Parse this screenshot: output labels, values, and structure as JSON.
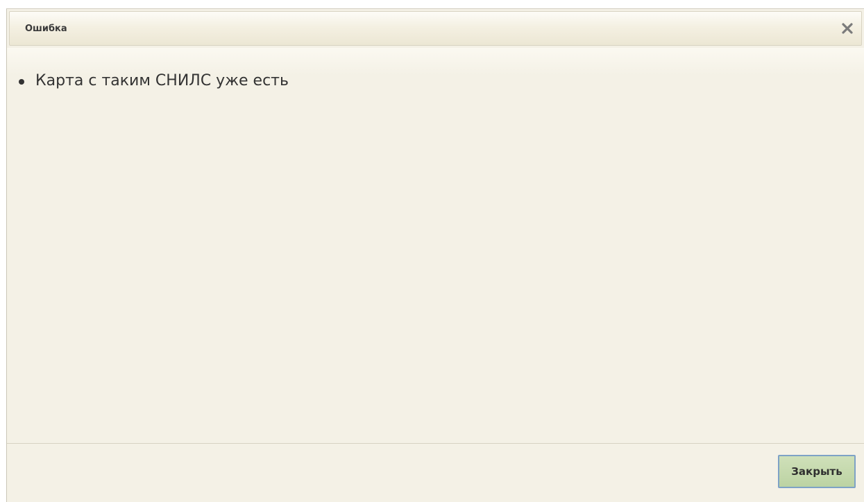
{
  "dialog": {
    "title": "Ошибка",
    "close_icon": "close-x-icon",
    "errors": [
      "Карта с таким СНИЛС уже есть"
    ],
    "close_button_label": "Закрыть"
  },
  "colors": {
    "background": "#f4f1e6",
    "button_fill": "#c4d8ab",
    "button_border": "#7ea2c6",
    "text": "#333333"
  }
}
